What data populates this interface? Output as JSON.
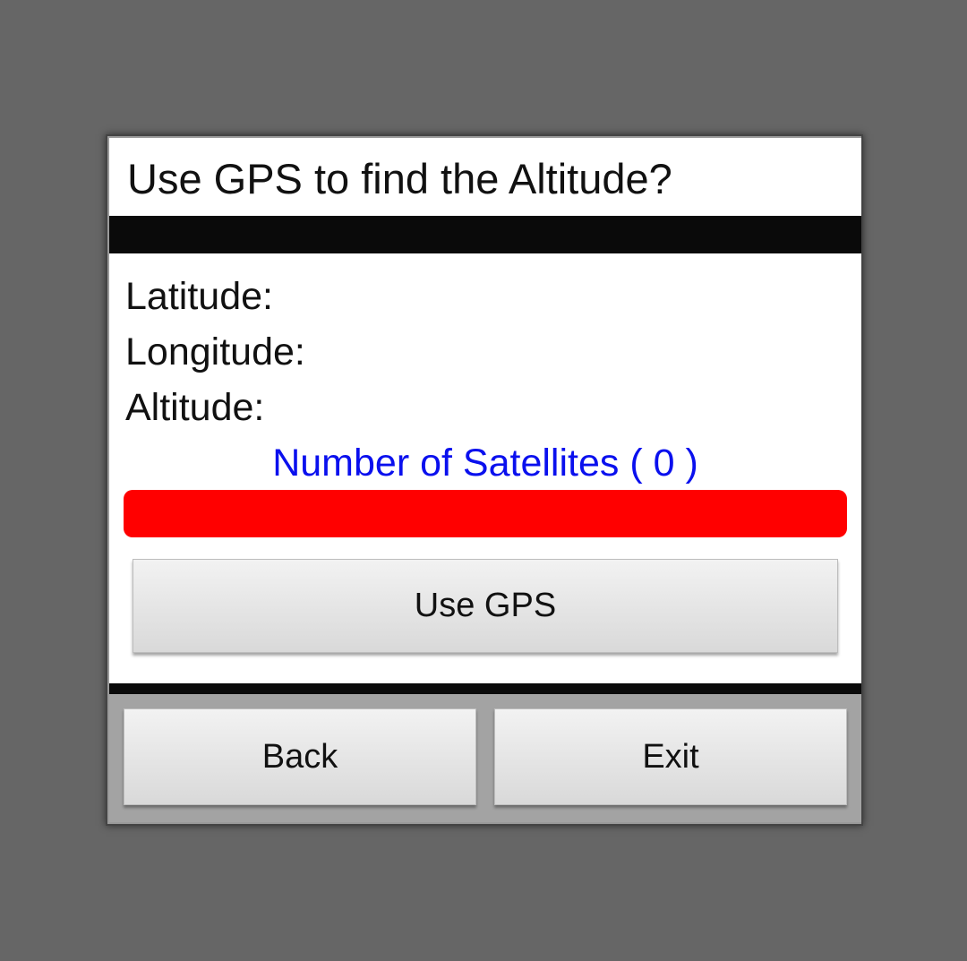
{
  "dialog": {
    "title": "Use GPS to find the Altitude?"
  },
  "fields": {
    "latitude_label": "Latitude:",
    "longitude_label": "Longitude:",
    "altitude_label": "Altitude:"
  },
  "satellites": {
    "label": "Number of Satellites ( 0 )",
    "label_color": "#0a10ee",
    "status_color": "#ff0000"
  },
  "buttons": {
    "use_gps": "Use GPS",
    "back": "Back",
    "exit": "Exit"
  }
}
